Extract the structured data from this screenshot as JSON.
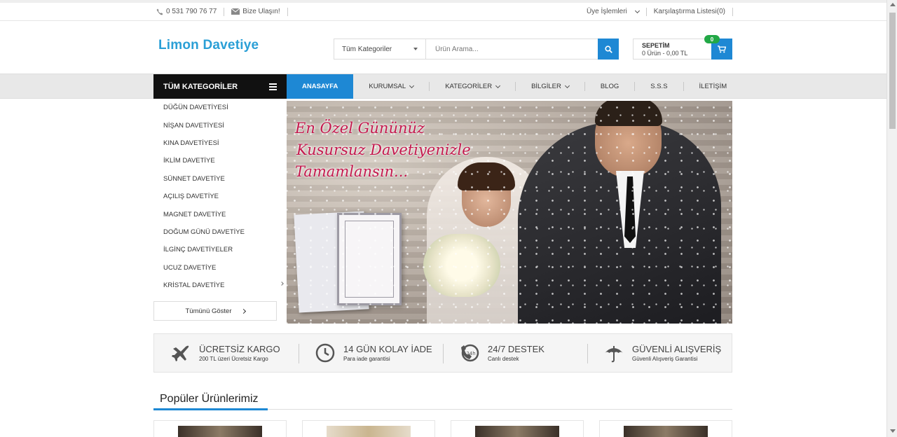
{
  "topbar": {
    "phone": "0 531 790 76 77",
    "contact": "Bize Ulaşın!",
    "account": "Üye İşlemleri",
    "compare": "Karşılaştırma Listesi(0)"
  },
  "header": {
    "logo": "Limon Davetiye",
    "search_category": "Tüm Kategoriler",
    "search_placeholder": "Ürün Arama...",
    "cart_title": "SEPETİM",
    "cart_summary": "0 Ürün - 0,00 TL",
    "cart_count": "0"
  },
  "nav": {
    "all_categories": "TÜM KATEGORİLER",
    "items": [
      {
        "label": "ANASAYFA"
      },
      {
        "label": "KURUMSAL"
      },
      {
        "label": "KATEGORİLER"
      },
      {
        "label": "BİLGİLER"
      },
      {
        "label": "BLOG"
      },
      {
        "label": "S.S.S"
      },
      {
        "label": "İLETİŞİM"
      }
    ]
  },
  "categories": {
    "items": [
      "DÜĞÜN DAVETİYESİ",
      "NİŞAN DAVETİYESİ",
      "KINA DAVETİYESİ",
      "İKLİM DAVETİYE",
      "SÜNNET DAVETİYE",
      "AÇILIŞ DAVETİYE",
      "MAGNET DAVETİYE",
      "DOĞUM GÜNÜ DAVETİYE",
      "İLGİNÇ DAVETİYELER",
      "UCUZ DAVETİYE",
      "KRİSTAL DAVETİYE"
    ],
    "show_all": "Tümünü Göster"
  },
  "hero": {
    "line1": "En Özel Gününüz",
    "line2": "Kusursuz Davetiyenizle",
    "line3": "Tamamlansın..."
  },
  "features": [
    {
      "title": "ÜCRETSİZ KARGO",
      "subtitle": "200 TL üzeri Ücretsiz Kargo",
      "icon": "airplane-icon"
    },
    {
      "title": "14 GÜN KOLAY İADE",
      "subtitle": "Para iade garantisi",
      "icon": "clock-icon"
    },
    {
      "title": "24/7 DESTEK",
      "subtitle": "Canlı destek",
      "icon": "support-24h-icon"
    },
    {
      "title": "GÜVENLİ ALIŞVERİŞ",
      "subtitle": "Güvenli Alışveriş Garantisi",
      "icon": "umbrella-icon"
    }
  ],
  "popular": {
    "title": "Popüler Ürünlerimiz"
  },
  "colors": {
    "accent": "#1e88d4",
    "logo": "#2a9fd6",
    "badge": "#22a846",
    "hero_text": "#c4184d"
  }
}
